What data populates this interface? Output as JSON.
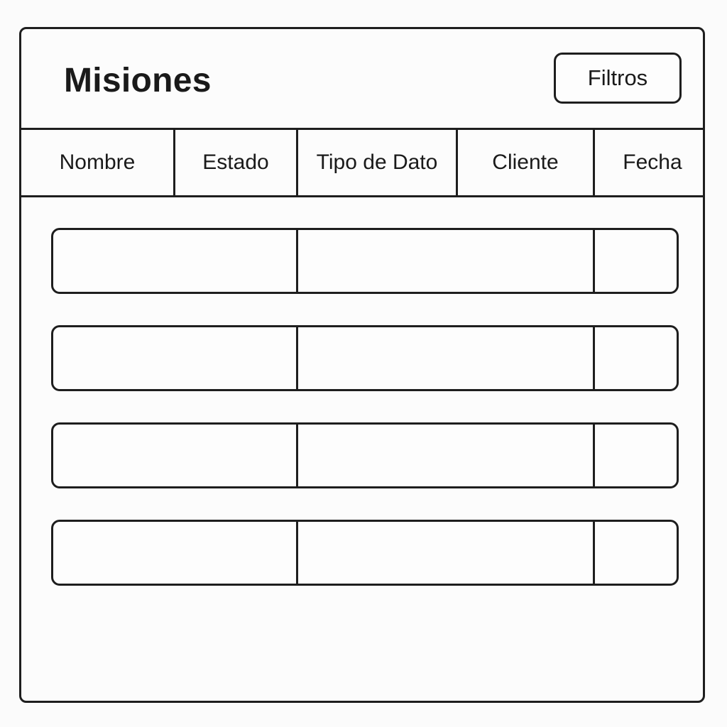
{
  "header": {
    "title": "Misiones",
    "filter_label": "Filtros"
  },
  "table": {
    "columns": [
      "Nombre",
      "Estado",
      "Tipo de Dato",
      "Cliente",
      "Fecha"
    ],
    "rows": [
      {
        "cells": [
          "",
          "",
          ""
        ]
      },
      {
        "cells": [
          "",
          "",
          ""
        ]
      },
      {
        "cells": [
          "",
          "",
          ""
        ]
      },
      {
        "cells": [
          "",
          "",
          ""
        ]
      }
    ]
  },
  "colors": {
    "stroke": "#1e1e1e",
    "background": "#fcfcfc"
  }
}
